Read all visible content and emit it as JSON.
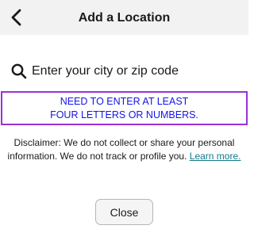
{
  "header": {
    "title": "Add a Location",
    "back_icon": "chevron-left-icon"
  },
  "search": {
    "icon": "search-icon",
    "placeholder": "Enter your city or zip code",
    "value": ""
  },
  "error": {
    "line1": "NEED TO ENTER AT LEAST",
    "line2": "FOUR LETTERS OR NUMBERS.",
    "border_color": "#9b30d9",
    "text_color": "#1515e6"
  },
  "disclaimer": {
    "line1": "Disclaimer: We do not collect or share your personal",
    "line2": "information. We do not track or profile you.",
    "link_label": "Learn more."
  },
  "footer": {
    "close_label": "Close"
  }
}
